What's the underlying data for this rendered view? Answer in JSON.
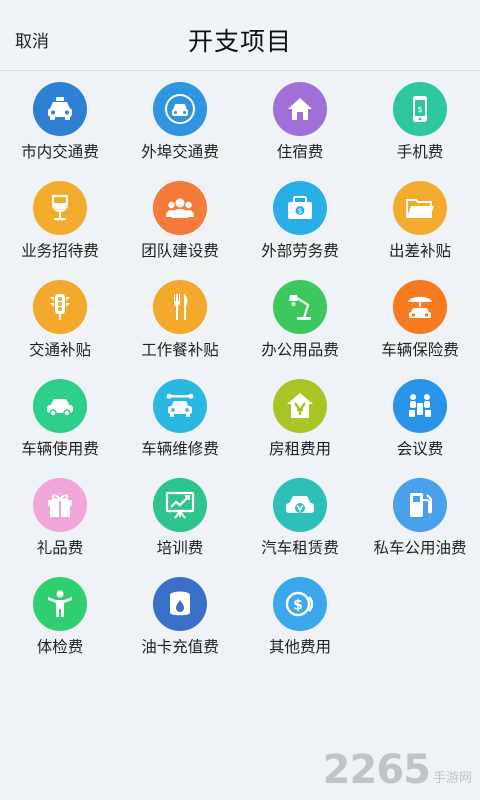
{
  "header": {
    "cancel_label": "取消",
    "title": "开支项目"
  },
  "items": [
    {
      "label": "市内交通费",
      "icon": "taxi-icon",
      "color": "#2f7fd3"
    },
    {
      "label": "外埠交通费",
      "icon": "bus-icon",
      "color": "#2f95e0"
    },
    {
      "label": "住宿费",
      "icon": "home-icon",
      "color": "#a070d8"
    },
    {
      "label": "手机费",
      "icon": "phone-icon",
      "color": "#2ec7a0"
    },
    {
      "label": "业务招待费",
      "icon": "wine-glass-icon",
      "color": "#f2ab2c"
    },
    {
      "label": "团队建设费",
      "icon": "team-icon",
      "color": "#f57b3a"
    },
    {
      "label": "外部劳务费",
      "icon": "wallet-icon",
      "color": "#2aaee8"
    },
    {
      "label": "出差补贴",
      "icon": "folder-icon",
      "color": "#f2ab2c"
    },
    {
      "label": "交通补贴",
      "icon": "traffic-light-icon",
      "color": "#f3a92c"
    },
    {
      "label": "工作餐补贴",
      "icon": "fork-knife-icon",
      "color": "#f3a92c"
    },
    {
      "label": "办公用品费",
      "icon": "desk-lamp-icon",
      "color": "#3cc85c"
    },
    {
      "label": "车辆保险费",
      "icon": "car-umbrella-icon",
      "color": "#f57a20"
    },
    {
      "label": "车辆使用费",
      "icon": "car-icon",
      "color": "#2ecf8a"
    },
    {
      "label": "车辆维修费",
      "icon": "car-wrench-icon",
      "color": "#2ab8e0"
    },
    {
      "label": "房租费用",
      "icon": "house-money-icon",
      "color": "#a8c425"
    },
    {
      "label": "会议费",
      "icon": "meeting-icon",
      "color": "#2a95e8"
    },
    {
      "label": "礼品费",
      "icon": "gift-icon",
      "color": "#f0a6d8"
    },
    {
      "label": "培训费",
      "icon": "presentation-icon",
      "color": "#2ec48c"
    },
    {
      "label": "汽车租赁费",
      "icon": "car-rental-icon",
      "color": "#2ec0b8"
    },
    {
      "label": "私车公用油费",
      "icon": "gas-pump-icon",
      "color": "#4aa0ea"
    },
    {
      "label": "体检费",
      "icon": "person-icon",
      "color": "#2ecf70"
    },
    {
      "label": "油卡充值费",
      "icon": "oil-barrel-icon",
      "color": "#3a6fc8"
    },
    {
      "label": "其他费用",
      "icon": "coins-icon",
      "color": "#3aa8ea"
    }
  ],
  "watermark": {
    "number": "2265",
    "text": "手游网"
  }
}
